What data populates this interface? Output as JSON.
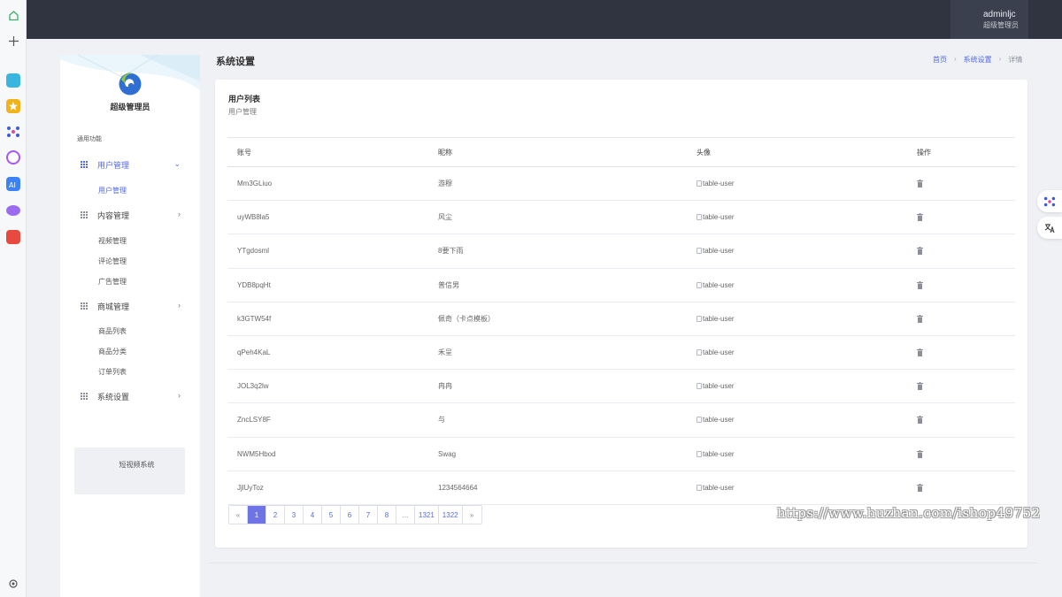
{
  "header": {
    "user_name": "adminljc",
    "user_role": "超级管理员"
  },
  "sidebar": {
    "admin_title": "超级管理员",
    "section_label": "通用功能",
    "groups": [
      {
        "label": "用户管理",
        "expanded": true,
        "items": [
          "用户管理"
        ]
      },
      {
        "label": "内容管理",
        "expanded": false,
        "items": [
          "视频管理",
          "评论管理",
          "广告管理"
        ]
      },
      {
        "label": "商城管理",
        "expanded": false,
        "items": [
          "商品列表",
          "商品分类",
          "订单列表"
        ]
      },
      {
        "label": "系统设置",
        "expanded": false,
        "items": []
      }
    ],
    "footer_card": "短视频系统"
  },
  "page": {
    "title": "系统设置",
    "breadcrumb": [
      "首页",
      "系统设置",
      "详情"
    ]
  },
  "card": {
    "title": "用户列表",
    "subtitle": "用户管理"
  },
  "table": {
    "columns": [
      "账号",
      "昵称",
      "头像",
      "操作"
    ],
    "rows": [
      {
        "account": "Mm3GLiuo",
        "nickname": "游穆",
        "avatar_alt": "table-user"
      },
      {
        "account": "uyWB8la5",
        "nickname": "风尘",
        "avatar_alt": "table-user"
      },
      {
        "account": "YTgdosml",
        "nickname": "8要下雨",
        "avatar_alt": "table-user"
      },
      {
        "account": "YDB8pqHt",
        "nickname": "普信男",
        "avatar_alt": "table-user"
      },
      {
        "account": "k3GTW54f",
        "nickname": "佩奇（卡点模板）",
        "avatar_alt": "table-user"
      },
      {
        "account": "qPeh4KaL",
        "nickname": "禾呈",
        "avatar_alt": "table-user"
      },
      {
        "account": "JOL3q2lw",
        "nickname": "冉冉",
        "avatar_alt": "table-user"
      },
      {
        "account": "ZncLSY8F",
        "nickname": "与",
        "avatar_alt": "table-user"
      },
      {
        "account": "NWM5Hbod",
        "nickname": "Swag",
        "avatar_alt": "table-user"
      },
      {
        "account": "JjlUyToz",
        "nickname": "1234564664",
        "avatar_alt": "table-user"
      }
    ]
  },
  "pagination": {
    "prev": "«",
    "pages": [
      "1",
      "2",
      "3",
      "4",
      "5",
      "6",
      "7",
      "8",
      "...",
      "1321",
      "1322"
    ],
    "next": "»",
    "current": "1"
  },
  "watermark": "https://www.huzhan.com/ishop49752",
  "colors": {
    "accent": "#5468e8",
    "header_bg": "#2f3440",
    "page_bg": "#f0f1f5"
  }
}
